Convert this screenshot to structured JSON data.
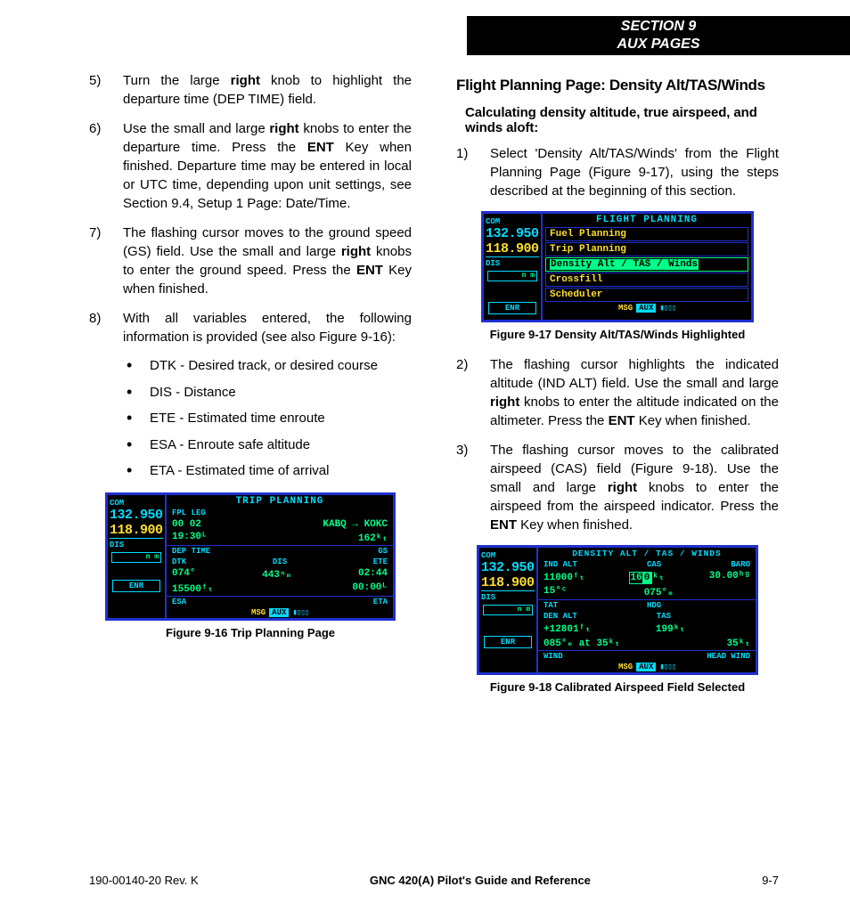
{
  "header": {
    "line1": "SECTION 9",
    "line2": "AUX PAGES"
  },
  "left": {
    "steps": [
      {
        "n": "5)",
        "html": "Turn the large <b>right</b> knob to highlight the departure time (DEP TIME) field."
      },
      {
        "n": "6)",
        "html": "Use the small and large <b>right</b> knobs to enter the departure time.  Press the <b>ENT</b> Key when finished.  Departure time may be entered in local or UTC time, depending upon unit settings, see Section 9.4, Setup 1 Page: Date/Time."
      },
      {
        "n": "7)",
        "html": "The flashing cursor moves to the ground speed (GS) field.  Use the small and large <b>right</b> knobs to enter the ground speed.  Press the <b>ENT</b> Key when finished."
      },
      {
        "n": "8)",
        "html": "With all variables entered, the following information is provided (see also Figure 9-16):"
      }
    ],
    "bullets": [
      "DTK - Desired track, or desired course",
      "DIS - Distance",
      "ETE - Estimated time enroute",
      "ESA - Enroute safe altitude",
      "ETA - Estimated time of arrival"
    ],
    "fig16_caption": "Figure 9-16  Trip Planning Page"
  },
  "right": {
    "heading": "Flight Planning Page: Density Alt/TAS/Winds",
    "subhead": "Calculating density altitude, true airspeed, and winds aloft:",
    "steps": [
      {
        "n": "1)",
        "html": "Select 'Density Alt/TAS/Winds' from the Flight Planning Page (Figure 9-17), using the steps described at the beginning of this section."
      }
    ],
    "fig17_caption": "Figure 9-17  Density Alt/TAS/Winds Highlighted",
    "steps2": [
      {
        "n": "2)",
        "html": "The flashing cursor highlights the indicated altitude (IND ALT) field.  Use the small and large <b>right</b> knobs to enter the altitude indicated on the altimeter.  Press the <b>ENT</b> Key when finished."
      },
      {
        "n": "3)",
        "html": "The flashing cursor moves to the calibrated airspeed (CAS) field (Figure 9-18).  Use the small and large <b>right</b> knobs to enter the airspeed from the airspeed indicator.  Press the <b>ENT</b> Key when finished."
      }
    ],
    "fig18_caption": "Figure 9-18  Calibrated Airspeed Field Selected"
  },
  "gps_side": {
    "com": "COM",
    "f1": "132.950",
    "f2": "118.900",
    "dis": "DIS",
    "nm": "n m",
    "enr": "ENR"
  },
  "fig16": {
    "title": "TRIP PLANNING",
    "sub1": "FPL  LEG",
    "r1a": "00  02",
    "r1b": "KABQ  →  KOKC",
    "r2a": "19:30ᴸ",
    "r2b": "162ᵏₜ",
    "sub2a": "DEP TIME",
    "sub2b": "GS",
    "sub3a": "DTK",
    "sub3b": "DIS",
    "sub3c": "ETE",
    "r3a": "074°",
    "r3b": "443ⁿₘ",
    "r3c": "02:44",
    "r4a": "15500ᶠₜ",
    "r4c": "00:00ᴸ",
    "sub4a": "ESA",
    "sub4c": "ETA",
    "msg": "MSG",
    "aux": "AUX"
  },
  "fig17": {
    "title": "FLIGHT PLANNING",
    "items": [
      "Fuel Planning",
      "Trip Planning",
      "Density Alt / TAS / Winds",
      "Crossfill",
      "Scheduler"
    ],
    "msg": "MSG",
    "aux": "AUX"
  },
  "fig18": {
    "title": "DENSITY ALT / TAS / WINDS",
    "sub1a": "IND ALT",
    "sub1b": "CAS",
    "sub1c": "BARO",
    "r1a": "11000ᶠₜ",
    "r1b_pre": "16",
    "r1b_sel": "0",
    "r1b_suf": "ᵏₜ",
    "r1c": "30.00ʰᵍ",
    "r2a": "15°ᶜ",
    "r2b": "075°ₘ",
    "sub2a": "TAT",
    "sub2b": "HDG",
    "sub3a": "DEN ALT",
    "sub3b": "TAS",
    "r3a": "+12801ᶠₜ",
    "r3b": "199ᵏₜ",
    "r4": "085°ₘ at 35ᵏₜ",
    "r4c": "35ᵏₜ",
    "sub4a": "WIND",
    "sub4c": "HEAD WIND",
    "msg": "MSG",
    "aux": "AUX"
  },
  "footer": {
    "left": "190-00140-20  Rev. K",
    "center": "GNC 420(A) Pilot's Guide and Reference",
    "right": "9-7"
  }
}
